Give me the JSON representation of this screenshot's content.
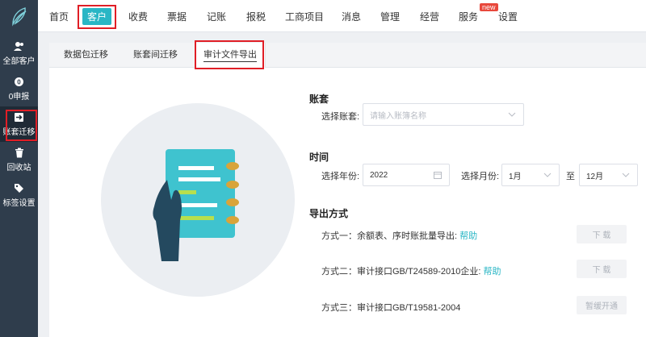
{
  "nav": {
    "items": [
      "首页",
      "客户",
      "收费",
      "票据",
      "记账",
      "报税",
      "工商项目",
      "消息",
      "管理",
      "经营",
      "服务",
      "设置"
    ],
    "active_index": 1,
    "badge": "new"
  },
  "sidebar": {
    "items": [
      {
        "label": "全部客户",
        "icon": "user-icon"
      },
      {
        "label": "0申报",
        "icon": "zero-icon"
      },
      {
        "label": "账套迁移",
        "icon": "migrate-icon"
      },
      {
        "label": "回收站",
        "icon": "trash-icon"
      },
      {
        "label": "标签设置",
        "icon": "tag-icon"
      }
    ],
    "active_index": 2
  },
  "tabs": [
    "数据包迁移",
    "账套间迁移",
    "审计文件导出"
  ],
  "active_tab": 2,
  "form": {
    "account_title": "账套",
    "account_label": "选择账套:",
    "account_placeholder": "请输入账簿名称",
    "time_title": "时间",
    "year_label": "选择年份:",
    "year_value": "2022",
    "month_label": "选择月份:",
    "month_from": "1月",
    "to_label": "至",
    "month_to": "12月",
    "export_title": "导出方式",
    "method1": "方式一：余额表、序时账批量导出:",
    "method2": "方式二：审计接口GB/T24589-2010企业:",
    "method3": "方式三：审计接口GB/T19581-2004",
    "help": "帮助",
    "download": "下 载",
    "coming_soon": "暂缓开通"
  },
  "colors": {
    "accent": "#29b6c5",
    "sidebar_bg": "#2f3d4c",
    "highlight_box": "#e01e26"
  }
}
